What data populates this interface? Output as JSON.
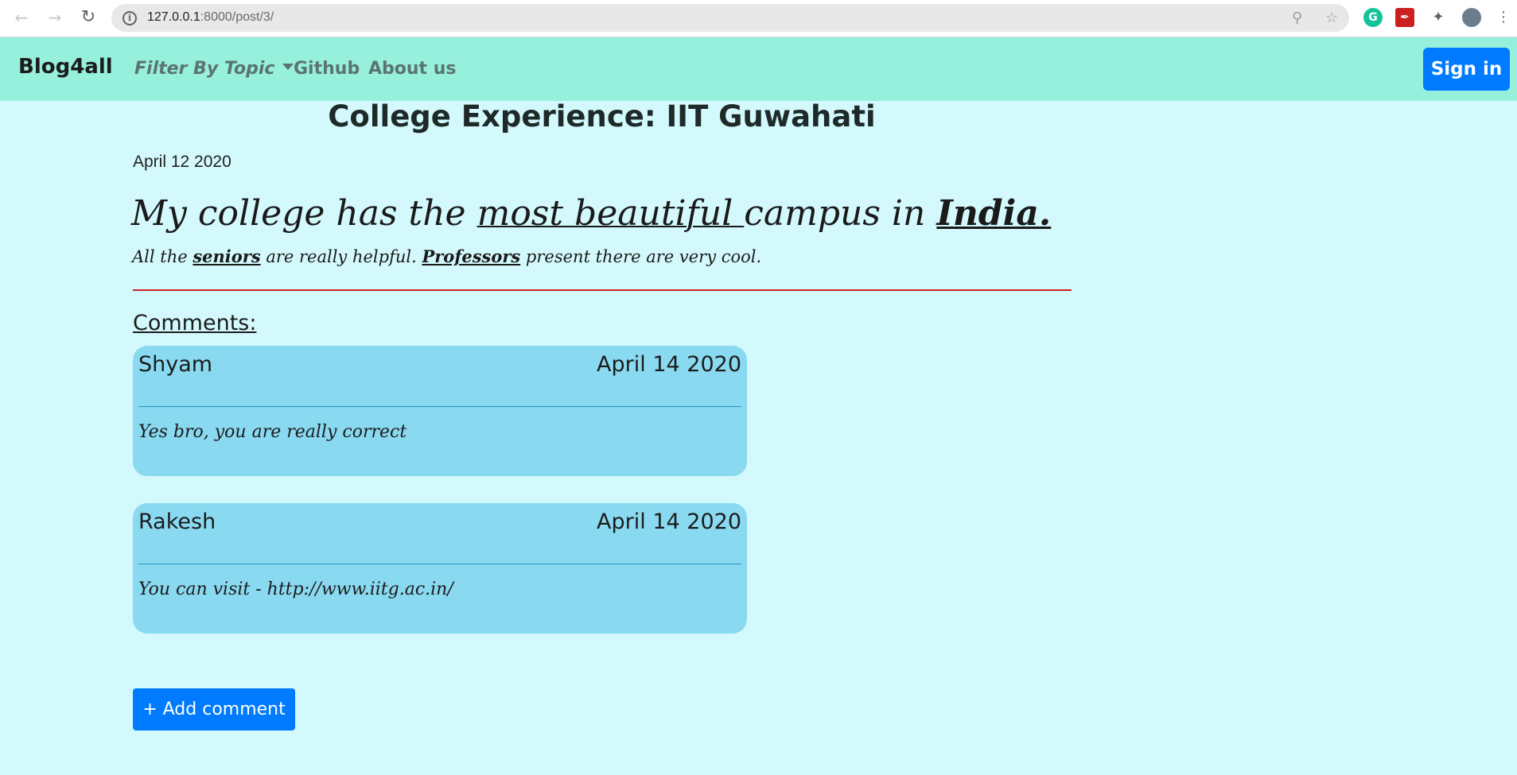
{
  "browser": {
    "url_host": "127.0.0.1",
    "url_rest": ":8000/post/3/"
  },
  "navbar": {
    "brand": "Blog4all",
    "filter_label": "Filter By Topic",
    "links": [
      "Github",
      "About us"
    ],
    "signin_label": "Sign in"
  },
  "post": {
    "title": "College Experience: IIT Guwahati",
    "date": "April 12 2020",
    "headline": {
      "part1": "My college has the ",
      "emph1": "most beautiful ",
      "part2": "campus in ",
      "emph2": "India."
    },
    "subline": {
      "part1": "All the ",
      "emph1": "seniors",
      "part2": " are really helpful. ",
      "emph2": "Professors",
      "part3": " present there are very cool."
    }
  },
  "comments_heading": "Comments:",
  "comments": [
    {
      "author": "Shyam",
      "date": "April 14 2020",
      "text": "Yes bro, you are really correct"
    },
    {
      "author": "Rakesh",
      "date": "April 14 2020",
      "text": "You can visit - http://www.iitg.ac.in/"
    }
  ],
  "add_comment_label": "+ Add comment",
  "colors": {
    "navbar_bg": "#97f0dc",
    "page_bg": "#d3f9fd",
    "comment_bg": "#89d9f1",
    "primary": "#007bff",
    "divider": "#d31d1d"
  }
}
